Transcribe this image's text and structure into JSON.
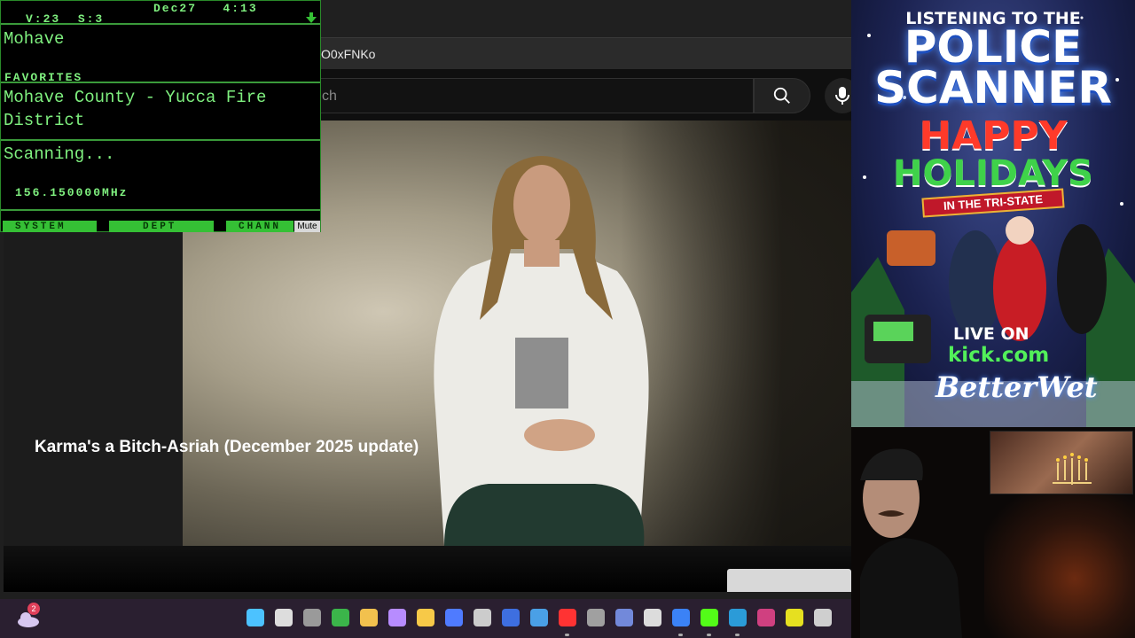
{
  "browser": {
    "address_fragment": "O0xFNKo",
    "search_placeholder_fragment": "ch"
  },
  "video": {
    "title": "Karma's a Bitch-Asriah (December 2025 update)"
  },
  "scanner": {
    "date": "Dec27",
    "time": "4:13",
    "volume": "V:23",
    "squelch": "S:3",
    "system": "Mohave",
    "favorites_label": "FAVORITES",
    "department": "Mohave County - Yucca Fire District",
    "status": "Scanning...",
    "frequency": "156.150000MHz",
    "buttons": [
      "SYSTEM",
      "DEPT",
      "CHANN"
    ],
    "mute_label": "Mute",
    "accent_color": "#7ff07f"
  },
  "promo": {
    "line1": "LISTENING TO THE",
    "line2": "POLICE",
    "line3": "SCANNER",
    "line4": "HAPPY",
    "line5": "HOLIDAYS",
    "line6": "IN THE TRI-STATE",
    "live": "LIVE ON",
    "kick": "kick.com",
    "signature": "BetterWet"
  },
  "taskbar": {
    "notification_count": "2",
    "icons": [
      "widgets-icon",
      "start-icon",
      "search-icon",
      "task-view-icon",
      "xbox-icon",
      "drive-icon",
      "copilot-icon",
      "file-explorer-icon",
      "store-icon",
      "app-icon",
      "notes-icon",
      "mail-icon",
      "youtube-icon",
      "settings-icon",
      "discord-icon",
      "calculator-icon",
      "messenger-icon",
      "kick-icon",
      "edge-icon",
      "voicemeeter-icon",
      "app2-icon",
      "obs-icon"
    ]
  }
}
